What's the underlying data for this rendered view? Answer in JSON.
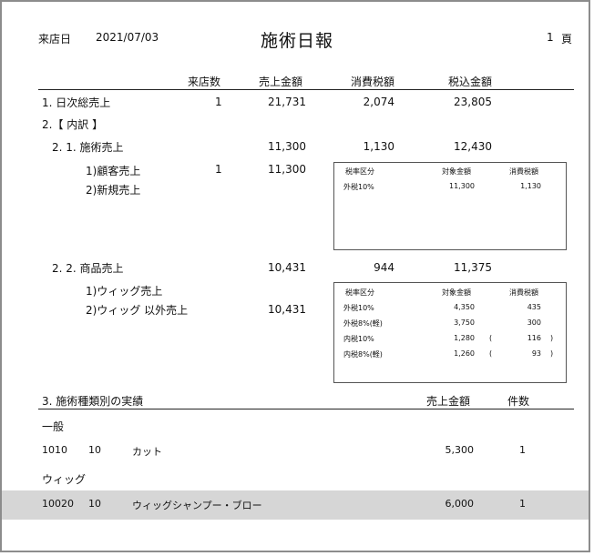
{
  "header": {
    "visit_date_label": "来店日",
    "visit_date": "2021/07/03",
    "title": "施術日報",
    "page_no": "1",
    "page_unit": "頁"
  },
  "columns": {
    "visitors": "来店数",
    "sales": "売上金額",
    "tax": "消費税額",
    "taxed": "税込金額"
  },
  "summary": {
    "label": "1. 日次総売上",
    "visitors": "1",
    "sales": "21,731",
    "tax": "2,074",
    "taxed": "23,805"
  },
  "breakdown_label": "2.【 内訳 】",
  "treatment": {
    "label": "2. 1. 施術売上",
    "sales": "11,300",
    "tax": "1,130",
    "taxed": "12,430",
    "sub1": {
      "label": "1)顧客売上",
      "visitors": "1",
      "sales": "11,300"
    },
    "sub2": {
      "label": "2)新規売上"
    },
    "taxbox": {
      "h_category": "税率区分",
      "h_amount": "対象金額",
      "h_tax": "消費税額",
      "rows": [
        {
          "category": "外税10%",
          "amount": "11,300",
          "tax": "1,130"
        }
      ]
    }
  },
  "product": {
    "label": "2. 2. 商品売上",
    "sales": "10,431",
    "tax": "944",
    "taxed": "11,375",
    "sub1": {
      "label": "1)ウィッグ売上"
    },
    "sub2": {
      "label": "2)ウィッグ 以外売上",
      "sales": "10,431"
    },
    "taxbox": {
      "h_category": "税率区分",
      "h_amount": "対象金額",
      "h_tax": "消費税額",
      "rows": [
        {
          "category": "外税10%",
          "amount": "4,350",
          "tax": "435"
        },
        {
          "category": "外税8%(軽)",
          "amount": "3,750",
          "tax": "300"
        },
        {
          "category": "内税10%",
          "amount": "1,280",
          "paren_open": "(",
          "tax": "116",
          "paren_close": ")"
        },
        {
          "category": "内税8%(軽)",
          "amount": "1,260",
          "paren_open": "(",
          "tax": "93",
          "paren_close": ")"
        }
      ]
    }
  },
  "section3": {
    "label": "3. 施術種類別の実績",
    "h_sales": "売上金額",
    "h_count": "件数"
  },
  "groups": [
    {
      "name": "一般",
      "items": [
        {
          "code": "1010",
          "sub": "10",
          "name": "カット",
          "sales": "5,300",
          "count": "1"
        }
      ]
    },
    {
      "name": "ウィッグ",
      "items": [
        {
          "code": "10020",
          "sub": "10",
          "name": "ウィッグシャンプー・ブロー",
          "sales": "6,000",
          "count": "1"
        }
      ]
    }
  ]
}
